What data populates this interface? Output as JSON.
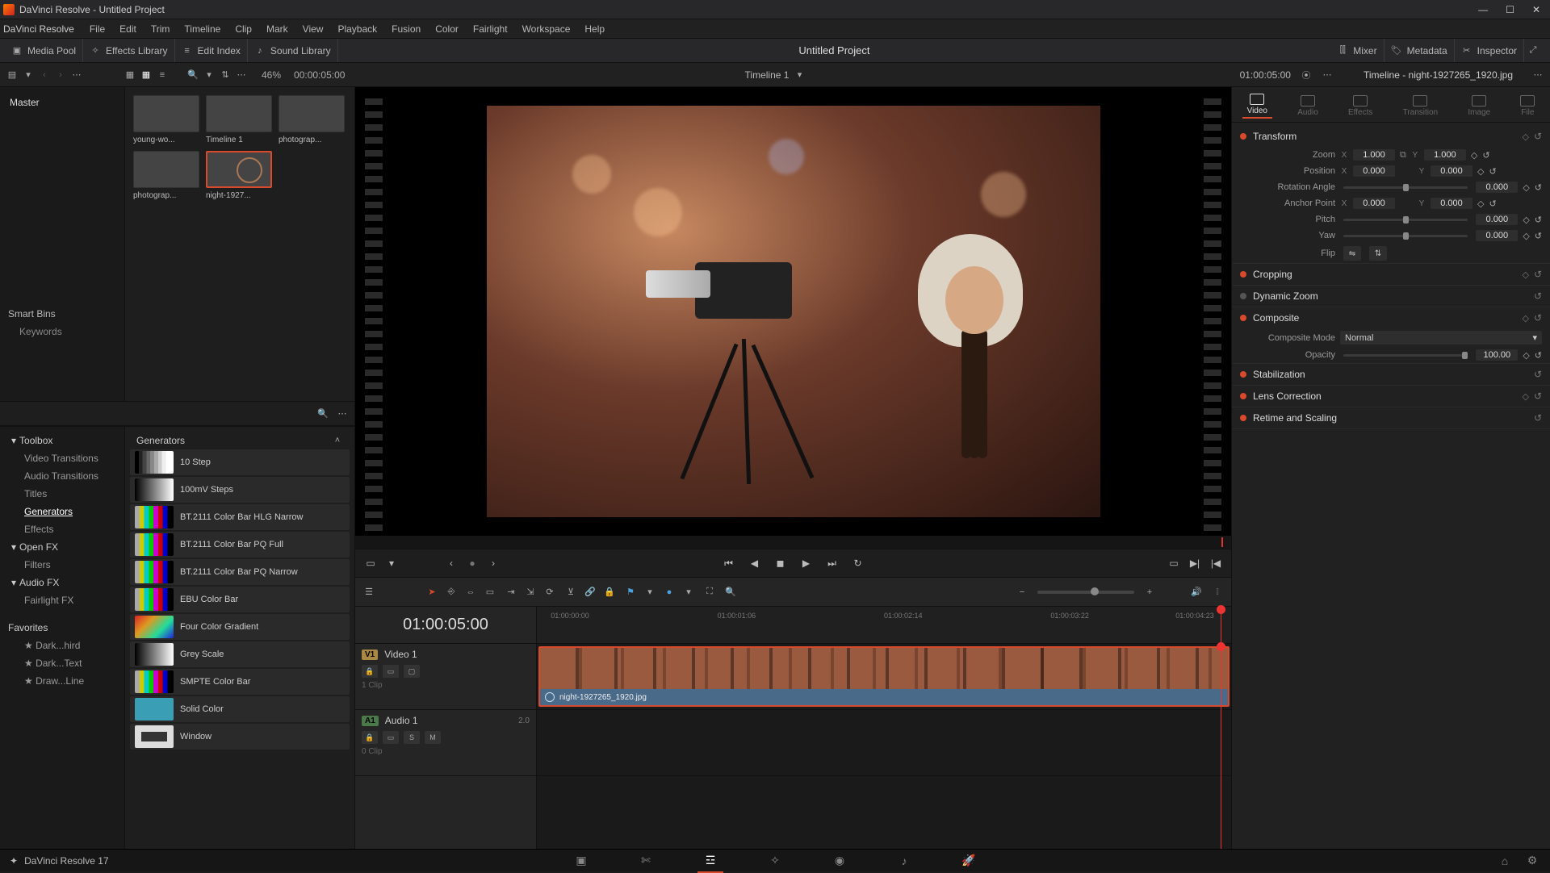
{
  "window": {
    "title": "DaVinci Resolve - Untitled Project"
  },
  "menu": {
    "app": "DaVinci Resolve",
    "items": [
      "File",
      "Edit",
      "Trim",
      "Timeline",
      "Clip",
      "Mark",
      "View",
      "Playback",
      "Fusion",
      "Color",
      "Fairlight",
      "Workspace",
      "Help"
    ]
  },
  "toolbar": {
    "media_pool": "Media Pool",
    "effects_library": "Effects Library",
    "edit_index": "Edit Index",
    "sound_library": "Sound Library",
    "project_title": "Untitled Project",
    "mixer": "Mixer",
    "metadata": "Metadata",
    "inspector": "Inspector"
  },
  "sec_toolbar": {
    "zoom_pct": "46%",
    "src_tc": "00:00:05:00",
    "timeline_name": "Timeline 1",
    "record_tc": "01:00:05:00",
    "inspector_title": "Timeline - night-1927265_1920.jpg"
  },
  "media_pool": {
    "master": "Master",
    "smart_bins": "Smart Bins",
    "keywords": "Keywords",
    "clips": [
      {
        "name": "young-wo...",
        "cls": "thumb-portrait"
      },
      {
        "name": "Timeline 1",
        "cls": "thumb-timeline"
      },
      {
        "name": "photograp...",
        "cls": "thumb-photo"
      },
      {
        "name": "photograp...",
        "cls": "thumb-night1"
      },
      {
        "name": "night-1927...",
        "cls": "thumb-night2",
        "selected": true
      }
    ]
  },
  "fx": {
    "categories": [
      {
        "label": "Toolbox",
        "group": true
      },
      {
        "label": "Video Transitions",
        "sub": true
      },
      {
        "label": "Audio Transitions",
        "sub": true
      },
      {
        "label": "Titles",
        "sub": true
      },
      {
        "label": "Generators",
        "sub": true,
        "active": true
      },
      {
        "label": "Effects",
        "sub": true
      },
      {
        "label": "Open FX",
        "group": true
      },
      {
        "label": "Filters",
        "sub": true
      },
      {
        "label": "Audio FX",
        "group": true
      },
      {
        "label": "Fairlight FX",
        "sub": true
      }
    ],
    "favorites_title": "Favorites",
    "favorites": [
      "Dark...hird",
      "Dark...Text",
      "Draw...Line"
    ],
    "header": "Generators",
    "items": [
      {
        "label": "10 Step",
        "sw": "sw-step"
      },
      {
        "label": "100mV Steps",
        "sw": "sw-100mv"
      },
      {
        "label": "BT.2111 Color Bar HLG Narrow",
        "sw": "sw-bars"
      },
      {
        "label": "BT.2111 Color Bar PQ Full",
        "sw": "sw-bars"
      },
      {
        "label": "BT.2111 Color Bar PQ Narrow",
        "sw": "sw-bars"
      },
      {
        "label": "EBU Color Bar",
        "sw": "sw-bars"
      },
      {
        "label": "Four Color Gradient",
        "sw": "sw-4color"
      },
      {
        "label": "Grey Scale",
        "sw": "sw-grey"
      },
      {
        "label": "SMPTE Color Bar",
        "sw": "sw-bars"
      },
      {
        "label": "Solid Color",
        "sw": "sw-solid"
      },
      {
        "label": "Window",
        "sw": "sw-window"
      }
    ]
  },
  "timeline": {
    "tc": "01:00:05:00",
    "ruler": [
      "01:00:00:00",
      "01:00:01:06",
      "01:00:02:14",
      "01:00:03:22",
      "01:00:04:23"
    ],
    "video_track": {
      "badge": "V1",
      "name": "Video 1",
      "clips": "1 Clip"
    },
    "audio_track": {
      "badge": "A1",
      "name": "Audio 1",
      "ch": "2.0",
      "clips": "0 Clip"
    },
    "clip_name": "night-1927265_1920.jpg"
  },
  "inspector": {
    "tabs": [
      "Video",
      "Audio",
      "Effects",
      "Transition",
      "Image",
      "File"
    ],
    "transform": {
      "title": "Transform",
      "zoom_label": "Zoom",
      "zoom_x": "1.000",
      "zoom_y": "1.000",
      "position_label": "Position",
      "pos_x": "0.000",
      "pos_y": "0.000",
      "rotation_label": "Rotation Angle",
      "rotation": "0.000",
      "anchor_label": "Anchor Point",
      "anchor_x": "0.000",
      "anchor_y": "0.000",
      "pitch_label": "Pitch",
      "pitch": "0.000",
      "yaw_label": "Yaw",
      "yaw": "0.000",
      "flip_label": "Flip"
    },
    "cropping": "Cropping",
    "dynamic_zoom": "Dynamic Zoom",
    "composite": {
      "title": "Composite",
      "mode_label": "Composite Mode",
      "mode": "Normal",
      "opacity_label": "Opacity",
      "opacity": "100.00"
    },
    "stabilization": "Stabilization",
    "lens": "Lens Correction",
    "retime": "Retime and Scaling"
  },
  "page_bar": {
    "app_version": "DaVinci Resolve 17"
  }
}
